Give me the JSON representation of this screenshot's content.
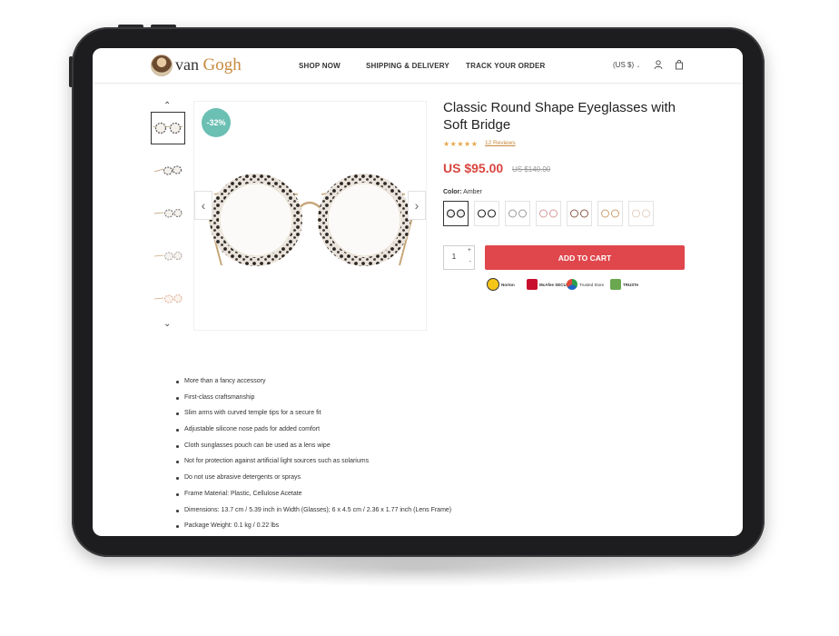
{
  "brand": {
    "name_plain": "van",
    "name_accent": "Gogh"
  },
  "nav": {
    "items": [
      {
        "label": "SHOP NOW"
      },
      {
        "label": "SHIPPING & DELIVERY"
      },
      {
        "label": "TRACK YOUR ORDER"
      }
    ],
    "currency": "(US $)"
  },
  "colors": {
    "accent": "#c9893d",
    "price_red": "#d9443e",
    "cart_button": "#e0474c",
    "badge": "#6bbfb3"
  },
  "gallery": {
    "discount_badge": "-32%",
    "thumbnail_count": 5,
    "selected_thumbnail": 1
  },
  "product": {
    "title": "Classic Round Shape Eyeglasses with Soft Bridge",
    "rating_stars": "★★★★★",
    "reviews": "12 Reviews",
    "price": "US $95.00",
    "old_price": "US $140.00",
    "color_label": "Color:",
    "color_value": "Amber",
    "color_swatches": 7,
    "selected_swatch": 1,
    "quantity": "1",
    "qty_plus": "+",
    "qty_minus": "-",
    "add_to_cart": "ADD TO CART"
  },
  "trust_badges": [
    {
      "name": "Norton",
      "icon": "norton-check-icon"
    },
    {
      "name": "McAfee SECURE",
      "icon": "mcafee-shield-icon"
    },
    {
      "name": "Trusted Store",
      "icon": "trusted-store-icon"
    },
    {
      "name": "TRUSTe",
      "icon": "truste-icon"
    }
  ],
  "features": [
    "More than a fancy accessory",
    "First-class craftsmanship",
    "Slim arms with curved temple tips for a secure fit",
    "Adjustable silicone nose pads for added comfort",
    "Cloth sunglasses pouch can be used as a lens wipe",
    "Not for protection against artificial light sources such as solariums",
    "Do not use abrasive detergents or sprays",
    "Frame Material: Plastic, Cellulose Acetate",
    "Dimensions: 13.7 cm / 5.39 inch in Width (Glasses); 6 x 4.5 cm / 2.36  x 1.77 inch (Lens Frame)",
    "Package Weight: 0.1 kg / 0.22 lbs"
  ]
}
